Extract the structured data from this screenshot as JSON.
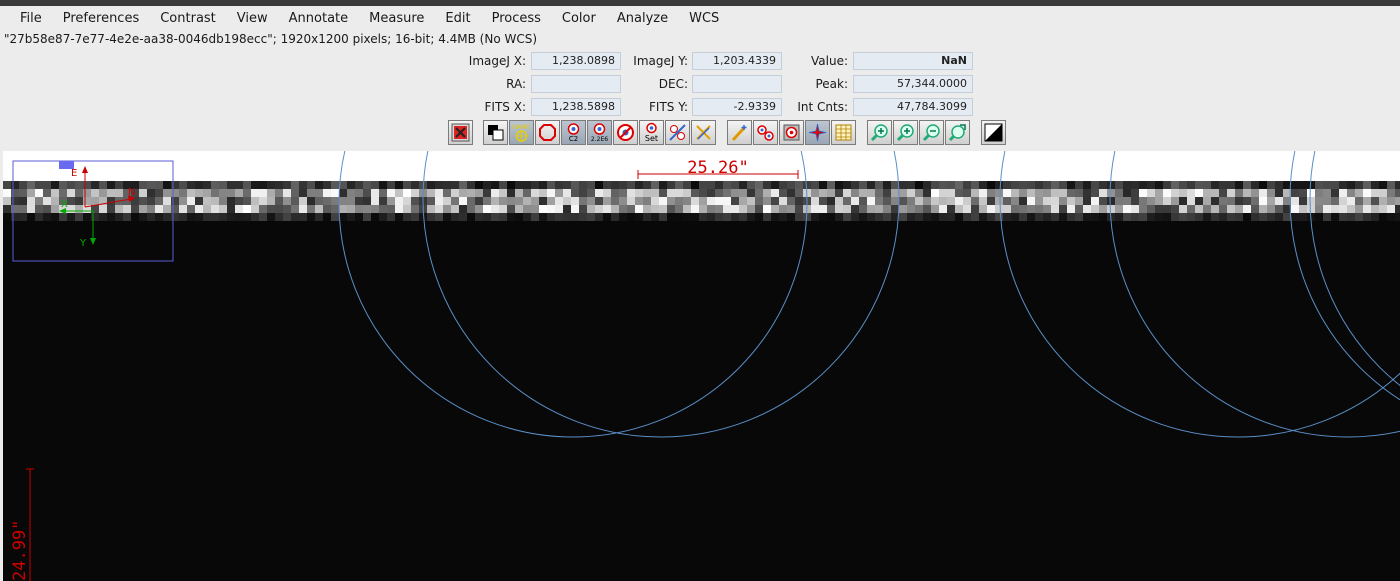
{
  "menu": [
    "File",
    "Preferences",
    "Contrast",
    "View",
    "Annotate",
    "Measure",
    "Edit",
    "Process",
    "Color",
    "Analyze",
    "WCS"
  ],
  "title_line": "\"27b58e87-7e77-4e2e-aa38-0046db198ecc\"; 1920x1200 pixels; 16-bit; 4.4MB (No WCS)",
  "info": {
    "imagej_x_label": "ImageJ X:",
    "imagej_x": "1,238.0898",
    "imagej_y_label": "ImageJ Y:",
    "imagej_y": "1,203.4339",
    "value_label": "Value:",
    "value": "NaN",
    "ra_label": "RA:",
    "ra": "",
    "dec_label": "DEC:",
    "dec": "",
    "peak_label": "Peak:",
    "peak": "57,344.0000",
    "fits_x_label": "FITS X:",
    "fits_x": "1,238.5898",
    "fits_y_label": "FITS Y:",
    "fits_y": "-2.9339",
    "int_cnts_label": "Int Cnts:",
    "int_cnts": "47,784.3099"
  },
  "toolbar": {
    "name_icon_text": "NAME",
    "c2_text": "C2",
    "c2266_text": "2.2E6",
    "set_text": "Set"
  },
  "colors": {
    "accent_red": "#cc0000",
    "aperture_blue": "#5a8fc8",
    "orient_blue": "#5b5bd6",
    "green": "#00aa00"
  },
  "image": {
    "scale_horizontal": "25.26\"",
    "scale_vertical": "24.99\"",
    "orient_e": "E",
    "orient_n": "N",
    "orient_x": "X",
    "orient_y": "Y"
  }
}
